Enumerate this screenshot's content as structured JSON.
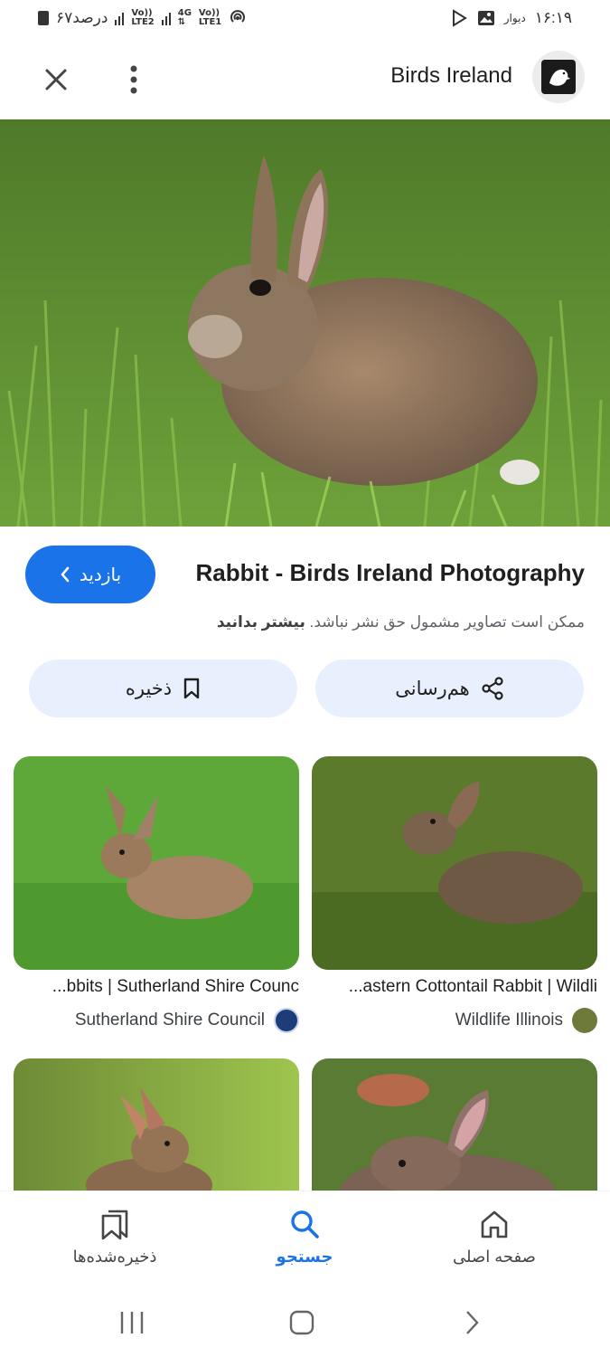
{
  "status_bar": {
    "battery_text": "۶۷درصد",
    "network_1": "LTE2",
    "network_2": "LTE1",
    "network_4g": "4G",
    "volte": "Vo))",
    "wall_label": "دیوار",
    "time": "۱۶:۱۹"
  },
  "app_bar": {
    "site_name": "Birds Ireland",
    "close_icon": "close-icon",
    "more_icon": "more-vert-icon"
  },
  "result": {
    "visit_label": "بازدید",
    "title": "Rabbit - Birds Ireland Photography",
    "copyright_text": "ممکن است تصاویر مشمول حق نشر نباشد.",
    "learn_more": "بیشتر بدانید",
    "save_label": "ذخیره",
    "share_label": "هم‌رسانی"
  },
  "related": [
    {
      "title": "Rabbits | Sutherland Shire Council",
      "title_visible": "...bbits | Sutherland Shire Counc",
      "source": "Sutherland Shire Council"
    },
    {
      "title": "Eastern Cottontail Rabbit | Wildlife Illinois",
      "title_visible": "...astern Cottontail Rabbit | Wildli",
      "source": "Wildlife Illinois"
    }
  ],
  "bottom_nav": {
    "saved_label": "ذخیره‌شده‌ها",
    "search_label": "جستجو",
    "home_label": "صفحه اصلی"
  },
  "colors": {
    "accent": "#1a73e8",
    "action_bg": "#e8f0fe"
  }
}
